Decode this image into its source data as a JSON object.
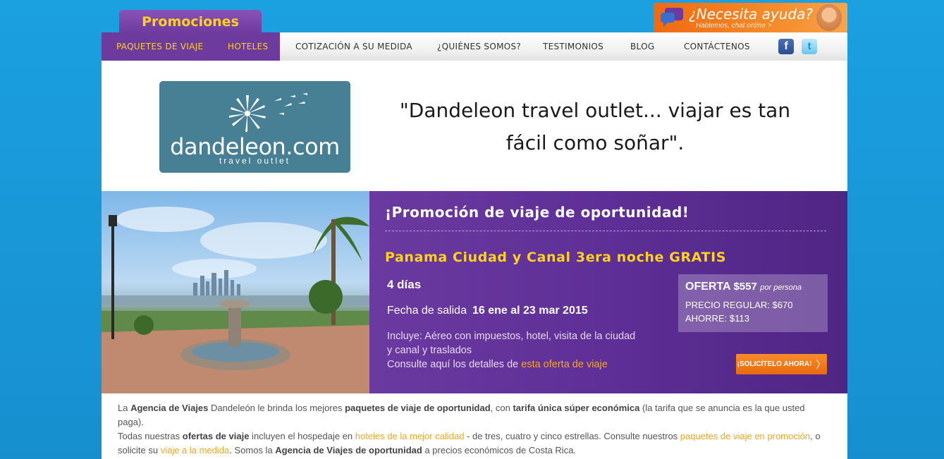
{
  "top": {
    "promo_tab": "Promociones",
    "help_title": "¿Necesita ayuda?",
    "help_sub": "Hablemos, chat online >"
  },
  "nav": {
    "items": [
      "PAQUETES DE VIAJE",
      "HOTELES",
      "COTIZACIÓN A SU MEDIDA",
      "¿QUIÉNES SOMOS?",
      "TESTIMONIOS",
      "BLOG",
      "CONTÁCTENOS"
    ],
    "facebook_icon": "facebook-icon",
    "twitter_icon": "twitter-icon"
  },
  "header": {
    "logo_text": "dandeleon.com",
    "logo_tag": "travel outlet",
    "tagline_1": "\"Dandeleon travel outlet... viajar es tan",
    "tagline_2": "fácil como soñar\"."
  },
  "promo": {
    "heading": "¡Promoción de viaje de oportunidad!",
    "offer_title": "Panama Ciudad y Canal 3era noche GRATIS",
    "days": "4 días",
    "salida_label": "Fecha de salida",
    "salida_value": "16 ene al 23 mar 2015",
    "incluye": "Incluye: Aéreo con impuestos, hotel, visita de la ciudad y canal y traslados",
    "consulte": "Consulte aquí los detalles de",
    "consulte_link": "esta oferta de viaje",
    "oferta_label": "OFERTA",
    "oferta_value": "$557",
    "oferta_pp": "por persona",
    "precio_regular": "PRECIO REGULAR: $670",
    "ahorre": "AHORRE: $113",
    "cta": "¡SOLICÍTELO AHORA!"
  },
  "content": {
    "p1": [
      "La ",
      "Agencia de Viajes",
      " Dandeleón le brinda los mejores ",
      "paquetes de viaje de oportunidad",
      ", con ",
      "tarifa única súper económica",
      " (la tarifa que se anuncia es la que usted paga)."
    ],
    "p2": [
      "Todas nuestras ",
      "ofertas de viaje",
      " incluyen el hospedaje en ",
      "hoteles de la mejor calidad",
      " - de tres, cuatro y cinco estrellas. Consulte nuestros ",
      "paquetes de viaje en promoción",
      ", o solicite su ",
      "viaje a la medida",
      ". Somos la ",
      "Agencia de Viajes de oportunidad",
      " a precios económicos de Costa Rica."
    ]
  }
}
